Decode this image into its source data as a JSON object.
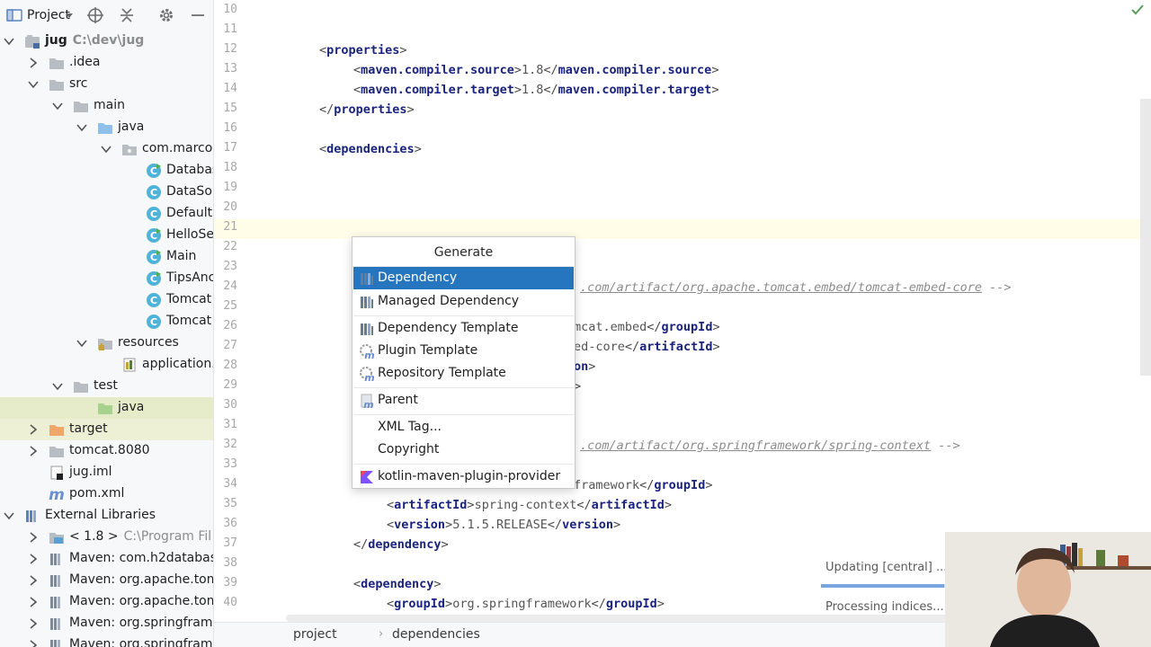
{
  "project_panel": {
    "title": "Project",
    "tree": [
      {
        "label": "jug",
        "sub": "C:\\dev\\jug",
        "bold": true
      },
      {
        "label": ".idea"
      },
      {
        "label": "src"
      },
      {
        "label": "main"
      },
      {
        "label": "java"
      },
      {
        "label": "com.marcol"
      },
      {
        "label": "Databas"
      },
      {
        "label": "DataSou"
      },
      {
        "label": "Default"
      },
      {
        "label": "HelloSe"
      },
      {
        "label": "Main"
      },
      {
        "label": "TipsAnc"
      },
      {
        "label": "Tomcat"
      },
      {
        "label": "Tomcat"
      },
      {
        "label": "resources"
      },
      {
        "label": "application."
      },
      {
        "label": "test"
      },
      {
        "label": "java"
      },
      {
        "label": "target"
      },
      {
        "label": "tomcat.8080"
      },
      {
        "label": "jug.iml"
      },
      {
        "label": "pom.xml"
      },
      {
        "label": "External Libraries"
      },
      {
        "label": "< 1.8 >",
        "sub": "C:\\Program Fil"
      },
      {
        "label": "Maven: com.h2databas"
      },
      {
        "label": "Maven: org.apache.tom"
      },
      {
        "label": "Maven: org.apache.tom"
      },
      {
        "label": "Maven: org.springfram"
      },
      {
        "label": "Maven: org.springfram"
      }
    ]
  },
  "editor": {
    "line_numbers": [
      "10",
      "11",
      "12",
      "13",
      "14",
      "15",
      "16",
      "17",
      "18",
      "19",
      "20",
      "21",
      "22",
      "23",
      "24",
      "25",
      "26",
      "27",
      "28",
      "29",
      "30",
      "31",
      "32",
      "33",
      "34",
      "35",
      "36",
      "37",
      "38",
      "39",
      "40"
    ],
    "code": {
      "l12_open": "properties",
      "l13_tag": "maven.compiler.source",
      "l13_val": "1.8",
      "l14_tag": "maven.compiler.target",
      "l14_val": "1.8",
      "l15_close": "properties",
      "l17_open": "dependencies",
      "l24_comment": ".com/artifact/org.apache.tomcat.embed/tomcat-embed-core",
      "l26_val": "mcat.embed",
      "l26_tag": "groupId",
      "l27_val": "ed-core",
      "l27_tag": "artifactId",
      "l28_tail": "on",
      "l32_comment": ".com/artifact/org.springframework/spring-context",
      "l34_val": "framework",
      "l34_tag": "groupId",
      "l35_tag": "artifactId",
      "l35_val": "spring-context",
      "l36_tag": "version",
      "l36_val": "5.1.5.RELEASE",
      "l37_close": "dependency",
      "l39_open": "dependency",
      "l40_tag": "groupId",
      "l40_val": "org.springframework"
    },
    "status_updating": "Updating [central] ...",
    "status_processing": "Processing indices...",
    "progress": 0.98
  },
  "generate_popup": {
    "title": "Generate",
    "items": [
      {
        "label": "Dependency",
        "icon": "maven-library-icon",
        "active": true
      },
      {
        "label": "Managed Dependency",
        "icon": "maven-library-icon"
      },
      {
        "label": "Dependency Template",
        "icon": "maven-library-icon"
      },
      {
        "label": "Plugin Template",
        "icon": "maven-plugin-icon"
      },
      {
        "label": "Repository Template",
        "icon": "maven-plugin-icon"
      },
      {
        "label": "Parent",
        "icon": "maven-icon"
      },
      {
        "label": "XML Tag...",
        "icon": ""
      },
      {
        "label": "Copyright",
        "icon": ""
      },
      {
        "label": "kotlin-maven-plugin-provider",
        "icon": "kotlin-icon"
      }
    ]
  },
  "breadcrumb": [
    "project",
    "dependencies"
  ],
  "colors": {
    "accent": "#2675bf",
    "tag": "#1a237e",
    "highlight_row": "#eef0d6"
  }
}
